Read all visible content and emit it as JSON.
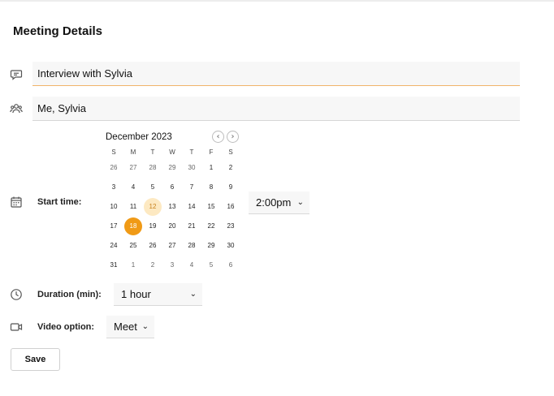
{
  "page": {
    "title": "Meeting Details"
  },
  "form": {
    "subject": {
      "value": "Interview with Sylvia",
      "icon": "chat-bubble-icon"
    },
    "attendees": {
      "value": "Me, Sylvia",
      "icon": "people-icon"
    },
    "start_time": {
      "label": "Start time:",
      "icon": "calendar-icon",
      "time_value": "2:00pm"
    },
    "duration": {
      "label": "Duration (min):",
      "icon": "clock-icon",
      "value": "1 hour"
    },
    "video": {
      "label": "Video option:",
      "icon": "video-camera-icon",
      "value": "Meet"
    },
    "save_label": "Save"
  },
  "calendar": {
    "month_label": "December 2023",
    "prev_label": "‹",
    "next_label": "›",
    "weekdays": [
      "S",
      "M",
      "T",
      "W",
      "T",
      "F",
      "S"
    ],
    "weeks": [
      [
        "26",
        "27",
        "28",
        "29",
        "30",
        "1",
        "2"
      ],
      [
        "3",
        "4",
        "5",
        "6",
        "7",
        "8",
        "9"
      ],
      [
        "10",
        "11",
        "12",
        "13",
        "14",
        "15",
        "16"
      ],
      [
        "17",
        "18",
        "19",
        "20",
        "21",
        "22",
        "23"
      ],
      [
        "24",
        "25",
        "26",
        "27",
        "28",
        "29",
        "30"
      ],
      [
        "31",
        "1",
        "2",
        "3",
        "4",
        "5",
        "6"
      ]
    ],
    "today": "12",
    "selected": "18"
  },
  "colors": {
    "accent": "#f09a16",
    "today_bg": "#fde9c2",
    "field_bg": "#f7f7f7",
    "focus_underline": "#f0b46a"
  }
}
